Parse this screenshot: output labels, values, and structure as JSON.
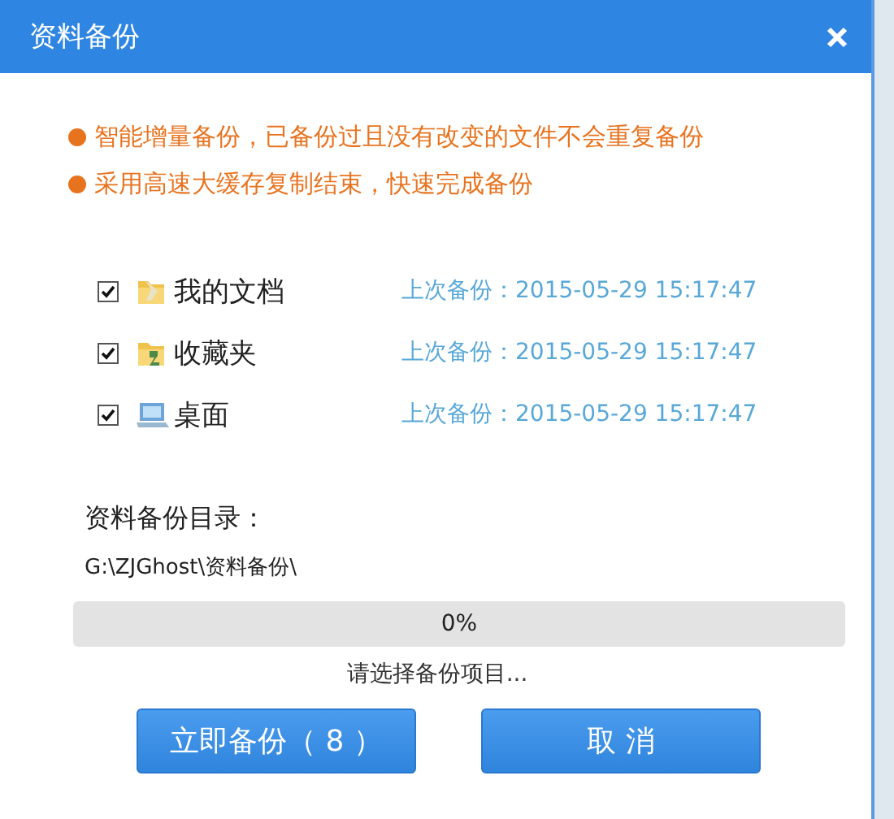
{
  "window": {
    "title": "资料备份"
  },
  "notes": [
    "智能增量备份，已备份过且没有改变的文件不会重复备份",
    "采用高速大缓存复制结束，快速完成备份"
  ],
  "items": [
    {
      "label": "我的文档",
      "checked": true,
      "kind": "documents",
      "last_backup": "上次备份：2015-05-29 15:17:47"
    },
    {
      "label": "收藏夹",
      "checked": true,
      "kind": "favorites",
      "last_backup": "上次备份：2015-05-29 15:17:47"
    },
    {
      "label": "桌面",
      "checked": true,
      "kind": "desktop",
      "last_backup": "上次备份：2015-05-29 15:17:47"
    }
  ],
  "directory": {
    "label": "资料备份目录：",
    "path": "G:\\ZJGhost\\资料备份\\"
  },
  "progress": {
    "level": 0,
    "reading": "0%"
  },
  "status": "请选择备份项目...",
  "buttons": [
    {
      "label": "立即备份（ 8 ）"
    },
    {
      "label": "取 消"
    }
  ]
}
